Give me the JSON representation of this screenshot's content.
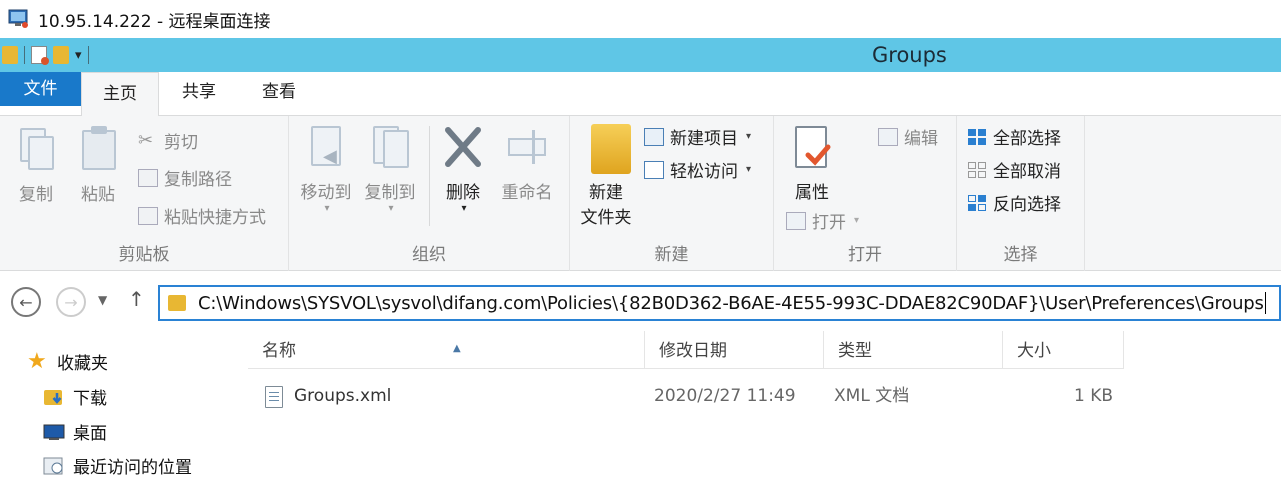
{
  "rdp": {
    "title": "10.95.14.222 - 远程桌面连接",
    "icon": "remote-desktop-icon"
  },
  "window": {
    "title": "Groups",
    "accent_color": "#5fc6e6"
  },
  "tabs": {
    "file": "文件",
    "home": "主页",
    "share": "共享",
    "view": "查看"
  },
  "ribbon": {
    "clipboard": {
      "label": "剪贴板",
      "copy": "复制",
      "paste": "粘贴",
      "cut": "剪切",
      "copy_path": "复制路径",
      "paste_shortcut": "粘贴快捷方式"
    },
    "organize": {
      "label": "组织",
      "move_to": "移动到",
      "copy_to": "复制到",
      "delete": "删除",
      "rename": "重命名"
    },
    "new": {
      "label": "新建",
      "new_folder_line1": "新建",
      "new_folder_line2": "文件夹",
      "new_item": "新建项目",
      "easy_access": "轻松访问"
    },
    "open": {
      "label": "打开",
      "properties": "属性",
      "open": "打开",
      "edit": "编辑"
    },
    "select": {
      "label": "选择",
      "select_all": "全部选择",
      "select_none": "全部取消",
      "invert": "反向选择"
    }
  },
  "address": {
    "path": "C:\\Windows\\SYSVOL\\sysvol\\difang.com\\Policies\\{82B0D362-B6AE-4E55-993C-DDAE82C90DAF}\\User\\Preferences\\Groups"
  },
  "nav": [
    {
      "label": "收藏夹",
      "icon": "star-icon"
    },
    {
      "label": "下载",
      "icon": "downloads-folder-icon"
    },
    {
      "label": "桌面",
      "icon": "desktop-icon"
    },
    {
      "label": "最近访问的位置",
      "icon": "recent-places-icon"
    }
  ],
  "columns": {
    "name": "名称",
    "modified": "修改日期",
    "type": "类型",
    "size": "大小"
  },
  "files": [
    {
      "name": "Groups.xml",
      "modified": "2020/2/27 11:49",
      "type": "XML 文档",
      "size": "1 KB",
      "icon": "xml-file-icon"
    }
  ]
}
